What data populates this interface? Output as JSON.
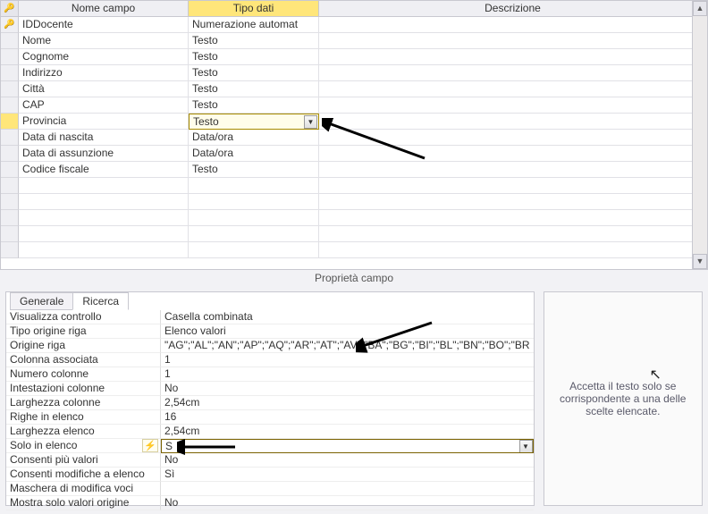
{
  "headers": {
    "field": "Nome campo",
    "type": "Tipo dati",
    "desc": "Descrizione"
  },
  "rows": [
    {
      "field": "IDDocente",
      "type": "Numerazione automat",
      "pk": true
    },
    {
      "field": "Nome",
      "type": "Testo"
    },
    {
      "field": "Cognome",
      "type": "Testo"
    },
    {
      "field": "Indirizzo",
      "type": "Testo"
    },
    {
      "field": "Città",
      "type": "Testo"
    },
    {
      "field": "CAP",
      "type": "Testo"
    },
    {
      "field": "Provincia",
      "type": "Testo",
      "selected": true
    },
    {
      "field": "Data di nascita",
      "type": "Data/ora"
    },
    {
      "field": "Data di assunzione",
      "type": "Data/ora"
    },
    {
      "field": "Codice fiscale",
      "type": "Testo"
    }
  ],
  "section_title": "Proprietà campo",
  "tabs": {
    "general": "Generale",
    "lookup": "Ricerca"
  },
  "props": [
    {
      "label": "Visualizza controllo",
      "value": "Casella combinata"
    },
    {
      "label": "Tipo origine riga",
      "value": "Elenco valori"
    },
    {
      "label": "Origine riga",
      "value": "\"AG\";\"AL\";\"AN\";\"AP\";\"AQ\";\"AR\";\"AT\";\"AV\";\"BA\";\"BG\";\"BI\";\"BL\";\"BN\";\"BO\";\"BR"
    },
    {
      "label": "Colonna associata",
      "value": "1"
    },
    {
      "label": "Numero colonne",
      "value": "1"
    },
    {
      "label": "Intestazioni colonne",
      "value": "No"
    },
    {
      "label": "Larghezza colonne",
      "value": "2,54cm"
    },
    {
      "label": "Righe in elenco",
      "value": "16"
    },
    {
      "label": "Larghezza elenco",
      "value": "2,54cm"
    },
    {
      "label": "Solo in elenco",
      "value": "S",
      "selected": true,
      "icon": true
    },
    {
      "label": "Consenti più valori",
      "value": "No"
    },
    {
      "label": "Consenti modifiche a elenco",
      "value": "Sì"
    },
    {
      "label": "Maschera di modifica voci",
      "value": ""
    },
    {
      "label": "Mostra solo valori origine",
      "value": "No"
    }
  ],
  "help_text": "Accetta il testo solo se corrispondente a una delle scelte elencate."
}
